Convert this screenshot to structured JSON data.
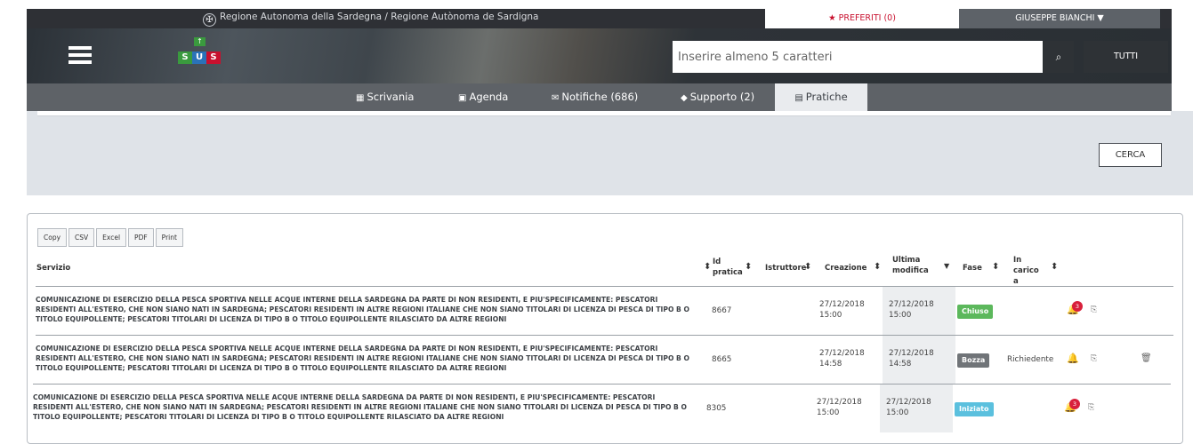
{
  "topbar": {
    "region": "Regione Autonoma della Sardegna / Regione Autònoma de Sardigna",
    "favorites": "PREFERITI (0)",
    "user": "GIUSEPPE BIANCHI ▼",
    "emblem_glyph": "✠"
  },
  "header": {
    "logo_letters": [
      "S",
      "U",
      "S"
    ],
    "logo_up": "↑",
    "search_placeholder": "Inserire almeno 5 caratteri",
    "search_icon": "search-icon",
    "search_glyph": "⌕",
    "scope": "TUTTI"
  },
  "nav": {
    "items": [
      {
        "label": "Scrivania",
        "icon": "grid-icon",
        "glyph": "▦"
      },
      {
        "label": "Agenda",
        "icon": "calendar-icon",
        "glyph": "▣"
      },
      {
        "label": "Notifiche (686)",
        "icon": "envelope-icon",
        "glyph": "✉"
      },
      {
        "label": "Supporto (2)",
        "icon": "tag-icon",
        "glyph": "◆"
      },
      {
        "label": "Pratiche",
        "icon": "document-icon",
        "glyph": "▤"
      }
    ],
    "active": "Pratiche"
  },
  "filters": {
    "search_button": "CERCA"
  },
  "exports": [
    "Copy",
    "CSV",
    "Excel",
    "PDF",
    "Print"
  ],
  "table": {
    "headers": {
      "servizio": "Servizio",
      "id": "Id pratica",
      "istruttore": "Istruttore",
      "creazione": "Creazione",
      "modifica": "Ultima modifica",
      "fase": "Fase",
      "carico": "In carico a"
    },
    "rows": [
      {
        "servizio": "COMUNICAZIONE DI ESERCIZIO DELLA PESCA SPORTIVA NELLE ACQUE INTERNE DELLA SARDEGNA DA PARTE DI NON RESIDENTI, E PIU'SPECIFICAMENTE: PESCATORI RESIDENTI ALL'ESTERO, CHE NON SIANO NATI IN SARDEGNA; PESCATORI RESIDENTI IN ALTRE REGIONI ITALIANE CHE NON SIANO TITOLARI DI LICENZA DI PESCA DI TIPO B O TITOLO EQUIPOLLENTE; PESCATORI TITOLARI DI LICENZA DI TIPO B O TITOLO EQUIPOLLENTE RILASCIATO DA ALTRE REGIONI",
        "id": "8667",
        "creazione_date": "27/12/2018",
        "creazione_time": "15:00",
        "modifica_date": "27/12/2018",
        "modifica_time": "15:00",
        "fase": "Chiuso",
        "fase_color": "#5cb85c",
        "carico": "",
        "notifications": "3"
      },
      {
        "servizio": "COMUNICAZIONE DI ESERCIZIO DELLA PESCA SPORTIVA NELLE ACQUE INTERNE DELLA SARDEGNA DA PARTE DI NON RESIDENTI, E PIU'SPECIFICAMENTE: PESCATORI RESIDENTI ALL'ESTERO, CHE NON SIANO NATI IN SARDEGNA; PESCATORI RESIDENTI IN ALTRE REGIONI ITALIANE CHE NON SIANO TITOLARI DI LICENZA DI PESCA DI TIPO B O TITOLO EQUIPOLLENTE; PESCATORI TITOLARI DI LICENZA DI TIPO B O TITOLO EQUIPOLLENTE RILASCIATO DA ALTRE REGIONI",
        "id": "8665",
        "creazione_date": "27/12/2018",
        "creazione_time": "14:58",
        "modifica_date": "27/12/2018",
        "modifica_time": "14:58",
        "fase": "Bozza",
        "fase_color": "#707478",
        "carico": "Richiedente",
        "notifications": ""
      },
      {
        "servizio": "COMUNICAZIONE DI ESERCIZIO DELLA PESCA SPORTIVA NELLE ACQUE INTERNE DELLA SARDEGNA DA PARTE DI NON RESIDENTI, E PIU'SPECIFICAMENTE: PESCATORI RESIDENTI ALL'ESTERO, CHE NON SIANO NATI IN SARDEGNA; PESCATORI RESIDENTI IN ALTRE REGIONI ITALIANE CHE NON SIANO TITOLARI DI LICENZA DI PESCA DI TIPO B O TITOLO EQUIPOLLENTE; PESCATORI TITOLARI DI LICENZA DI TIPO B O TITOLO EQUIPOLLENTE RILASCIATO DA ALTRE REGIONI",
        "id": "8305",
        "creazione_date": "27/12/2018",
        "creazione_time": "15:00",
        "modifica_date": "27/12/2018",
        "modifica_time": "15:00",
        "fase": "Iniziato",
        "fase_color": "#5bc0de",
        "carico": "",
        "notifications": "3"
      }
    ]
  },
  "icons": {
    "bell": "bell-icon",
    "pdf": "pdf-icon",
    "trash": "trash-icon",
    "sort": "sort-icon"
  },
  "glyphs": {
    "star": "★",
    "bell": "🔔",
    "pdf": "⎘",
    "trash": "🗑",
    "sort": "⬍",
    "sort_desc": "▼"
  }
}
